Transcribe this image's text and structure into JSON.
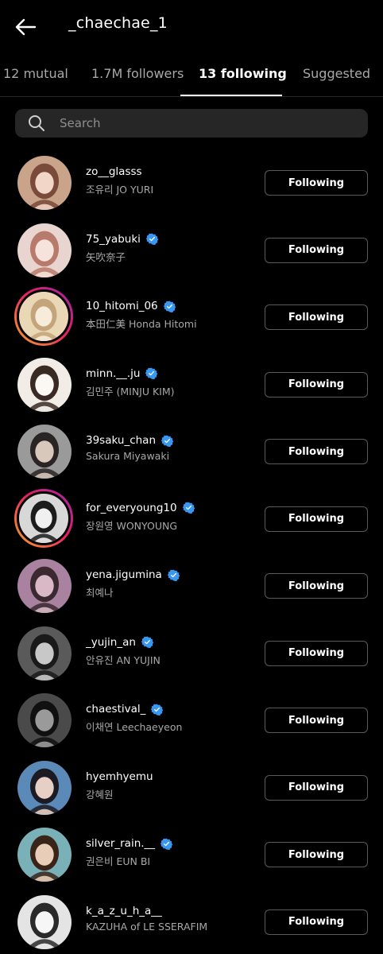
{
  "header": {
    "title": "_chaechae_1"
  },
  "tabs": [
    {
      "label": "12 mutual"
    },
    {
      "label": "1.7M followers"
    },
    {
      "label": "13 following"
    },
    {
      "label": "Suggested"
    }
  ],
  "search": {
    "placeholder": "Search"
  },
  "users": [
    {
      "username": "zo__glasss",
      "fullname": "조유리 JO YURI",
      "button": "Following",
      "verified": false,
      "story": false,
      "colors": [
        "#c9a48a",
        "#f2d6c8",
        "#7a4a3a"
      ]
    },
    {
      "username": "75_yabuki",
      "fullname": "矢吹奈子",
      "button": "Following",
      "verified": true,
      "story": false,
      "colors": [
        "#e8d5d0",
        "#f6e3dc",
        "#b87a6a"
      ]
    },
    {
      "username": "10_hitomi_06",
      "fullname": "本田仁美 Honda Hitomi",
      "button": "Following",
      "verified": true,
      "story": true,
      "colors": [
        "#e9d7b5",
        "#f7ecd9",
        "#c4a47a"
      ]
    },
    {
      "username": "minn.__.ju",
      "fullname": "김민주 (MINJU KIM)",
      "button": "Following",
      "verified": true,
      "story": false,
      "colors": [
        "#f2ece6",
        "#fbf7f3",
        "#3a2a24"
      ]
    },
    {
      "username": "39saku_chan",
      "fullname": "Sakura Miyawaki",
      "button": "Following",
      "verified": true,
      "story": false,
      "colors": [
        "#9a9a9a",
        "#d8c8bc",
        "#2a2424"
      ]
    },
    {
      "username": "for_everyoung10",
      "fullname": "장원영 WONYOUNG",
      "button": "Following",
      "verified": true,
      "story": true,
      "colors": [
        "#d8d8d8",
        "#f0f0f0",
        "#1c1c1c"
      ]
    },
    {
      "username": "yena.jigumina",
      "fullname": "최예나",
      "button": "Following",
      "verified": true,
      "story": false,
      "colors": [
        "#a8829e",
        "#d9b9c6",
        "#3a2a30"
      ]
    },
    {
      "username": "_yujin_an",
      "fullname": "안유진 AN YUJIN",
      "button": "Following",
      "verified": true,
      "story": false,
      "colors": [
        "#5a5a5a",
        "#c8c8c8",
        "#1a1a1a"
      ]
    },
    {
      "username": "chaestival_",
      "fullname": "이채연 Leechaeyeon",
      "button": "Following",
      "verified": true,
      "story": false,
      "colors": [
        "#4a4a4a",
        "#9a9a9a",
        "#101010"
      ]
    },
    {
      "username": "hyemhyemu",
      "fullname": "강혜원",
      "button": "Following",
      "verified": false,
      "story": false,
      "colors": [
        "#5c8ab8",
        "#e6d0c6",
        "#1c1a22"
      ]
    },
    {
      "username": "silver_rain.__",
      "fullname": "권은비 EUN BI",
      "button": "Following",
      "verified": true,
      "story": false,
      "colors": [
        "#7ab0b8",
        "#e8cdb8",
        "#3a2418"
      ]
    },
    {
      "username": "k_a_z_u_h_a__",
      "fullname": "KAZUHA of LE SSERAFIM",
      "button": "Following",
      "verified": false,
      "story": false,
      "colors": [
        "#e4e4e4",
        "#f6f6f6",
        "#2a2a2a"
      ]
    }
  ],
  "colors": {
    "background": "#000000",
    "verified": "#3897f0",
    "muted_text": "#a8a8a8",
    "search_bg": "#262626"
  },
  "icons": {
    "back": "back-arrow-icon",
    "search": "search-icon",
    "verified": "verified-badge-icon"
  }
}
